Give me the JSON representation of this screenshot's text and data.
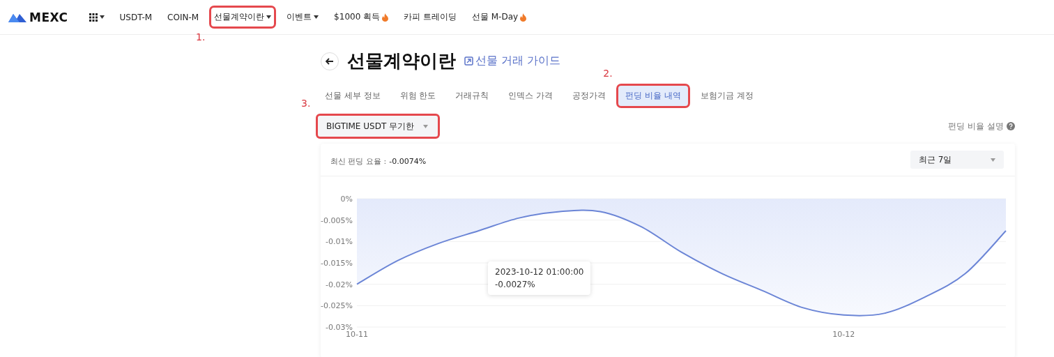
{
  "nav": {
    "logo": "MEXC",
    "items": [
      {
        "label": "USDT-M",
        "kind": "link"
      },
      {
        "label": "COIN-M",
        "kind": "link"
      },
      {
        "label": "선물계약이란",
        "kind": "menu",
        "callout": "1."
      },
      {
        "label": "이벤트",
        "kind": "menu"
      },
      {
        "label": "$1000 획득",
        "kind": "hot"
      },
      {
        "label": "카피 트레이딩",
        "kind": "link"
      },
      {
        "label": "선물 M-Day",
        "kind": "hot"
      }
    ]
  },
  "page": {
    "title": "선물계약이란",
    "guide_link": "선물 거래 가이드"
  },
  "tabs": [
    {
      "label": "선물 세부 정보",
      "selected": false
    },
    {
      "label": "위험 한도",
      "selected": false
    },
    {
      "label": "거래규칙",
      "selected": false
    },
    {
      "label": "인덱스 가격",
      "selected": false
    },
    {
      "label": "공정가격",
      "selected": false
    },
    {
      "label": "펀딩 비율 내역",
      "selected": true,
      "callout": "2."
    },
    {
      "label": "보험기금 계정",
      "selected": false
    }
  ],
  "contract_select": {
    "value": "BIGTIME USDT 무기한",
    "callout": "3."
  },
  "explain_link": "펀딩 비율 설명",
  "chart_card": {
    "latest_label": "최신 펀딩 요율 :",
    "latest_value": "-0.0074%",
    "period": "최근 7일",
    "chart_data": {
      "type": "area",
      "categories": [
        "10-11",
        null,
        null,
        null,
        null,
        null,
        null,
        null,
        null,
        null,
        null,
        null,
        "10-12",
        null,
        null,
        null,
        null
      ],
      "series": [
        {
          "color": "#6b85d6",
          "values": [
            -0.02,
            -0.0145,
            -0.0105,
            -0.0075,
            -0.0045,
            -0.003,
            -0.003,
            -0.0065,
            -0.0125,
            -0.0175,
            -0.0215,
            -0.0255,
            -0.0272,
            -0.0268,
            -0.023,
            -0.0175,
            -0.0075
          ]
        }
      ],
      "ylim": [
        -0.03,
        0
      ],
      "grid": true,
      "yticks": [
        {
          "value": 0,
          "label": "0%"
        },
        {
          "value": -0.005,
          "label": "-0.005%"
        },
        {
          "value": -0.01,
          "label": "-0.01%"
        },
        {
          "value": -0.015,
          "label": "-0.015%"
        },
        {
          "value": -0.02,
          "label": "-0.02%"
        },
        {
          "value": -0.025,
          "label": "-0.025%"
        },
        {
          "value": -0.03,
          "label": "-0.03%"
        }
      ]
    },
    "tooltip": {
      "time": "2023-10-12 01:00:00",
      "value": "-0.0027%"
    }
  }
}
